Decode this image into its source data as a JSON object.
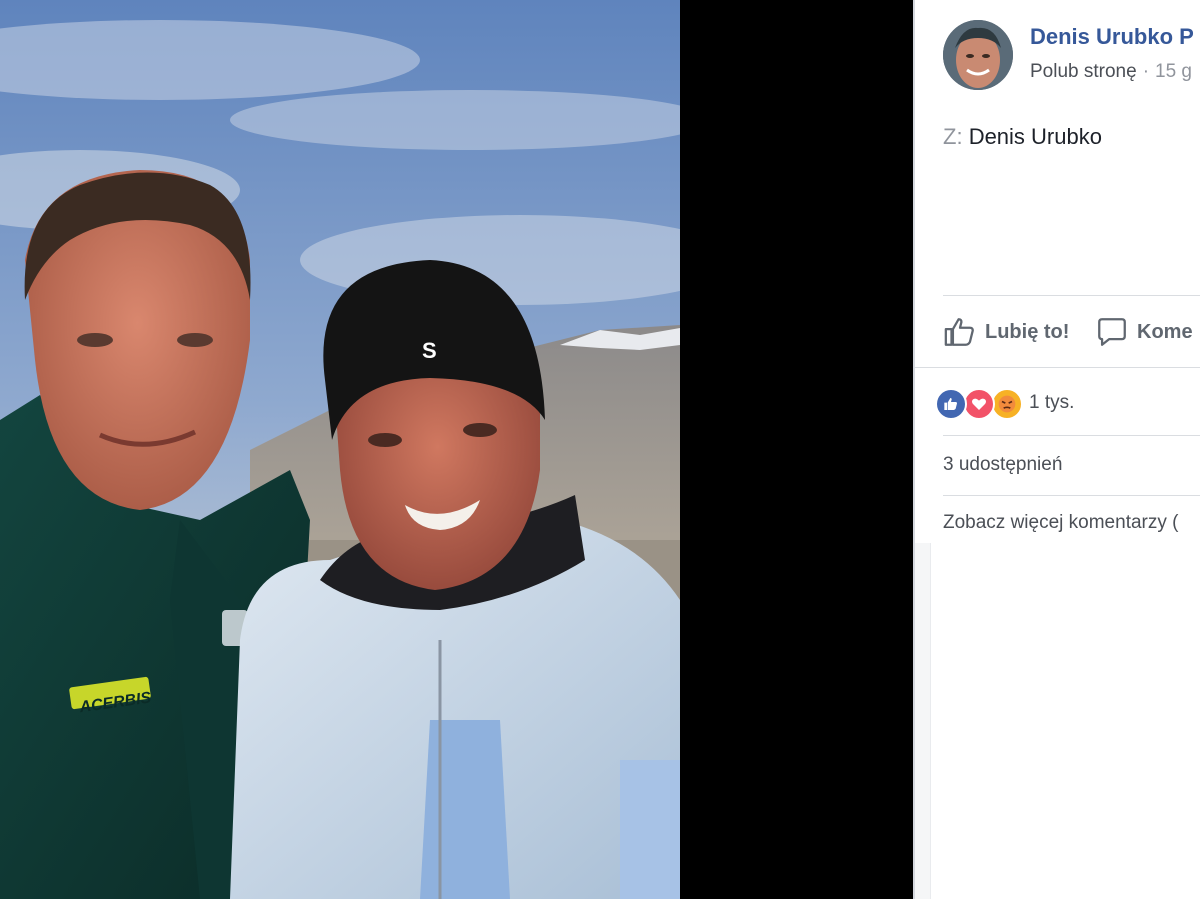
{
  "post": {
    "page_name": "Denis Urubko P",
    "like_page_label": "Polub stronę",
    "separator": "·",
    "time": "15 g",
    "from_prefix": "Z:",
    "from_name": "Denis Urubko"
  },
  "actions": {
    "like_label": "Lubię to!",
    "comment_label": "Kome"
  },
  "reactions": {
    "icons": [
      "like-icon",
      "love-icon",
      "angry-icon"
    ],
    "count": "1 tys."
  },
  "shares_text": "3 udostępnień",
  "more_comments_text": "Zobacz więcej komentarzy (",
  "photo": {
    "jacket_logo": "ACERBIS",
    "hat_logo": "S"
  },
  "colors": {
    "link_blue": "#365899",
    "like_blue": "#4267b2",
    "love_red": "#f25268",
    "angry_orange": "#f7b125"
  }
}
